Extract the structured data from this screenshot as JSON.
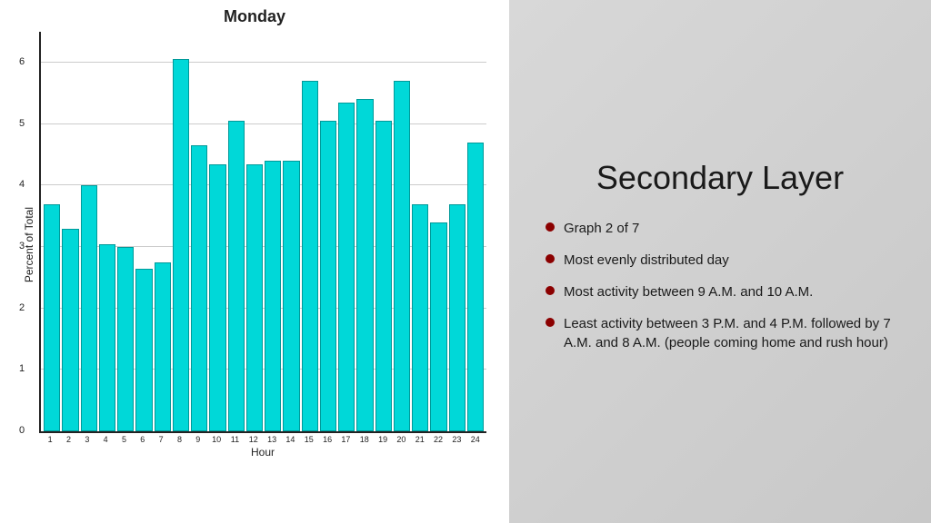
{
  "chart": {
    "title": "Monday",
    "y_axis_label": "Percent of Total",
    "x_axis_label": "Hour",
    "y_ticks": [
      0,
      1,
      2,
      3,
      4,
      5,
      6
    ],
    "x_ticks": [
      "1",
      "2",
      "3",
      "4",
      "5",
      "6",
      "7",
      "8",
      "9",
      "10",
      "11",
      "12",
      "13",
      "14",
      "15",
      "16",
      "17",
      "18",
      "19",
      "20",
      "21",
      "22",
      "23",
      "24"
    ],
    "bars": [
      3.05,
      3.7,
      3.3,
      4.0,
      3.05,
      3.0,
      2.65,
      2.75,
      6.05,
      4.65,
      4.35,
      5.05,
      4.35,
      4.4,
      4.4,
      5.7,
      5.05,
      5.35,
      5.4,
      5.05,
      5.7,
      3.7,
      3.4,
      3.7,
      4.7
    ],
    "max_value": 6.5,
    "bar_count": 24
  },
  "right_panel": {
    "title": "Secondary Layer",
    "bullets": [
      "Graph 2 of 7",
      "Most evenly distributed day",
      "Most activity between 9 A.M. and 10 A.M.",
      "Least activity between 3 P.M. and 4 P.M. followed by 7 A.M. and 8 A.M. (people coming home and rush hour)"
    ]
  }
}
